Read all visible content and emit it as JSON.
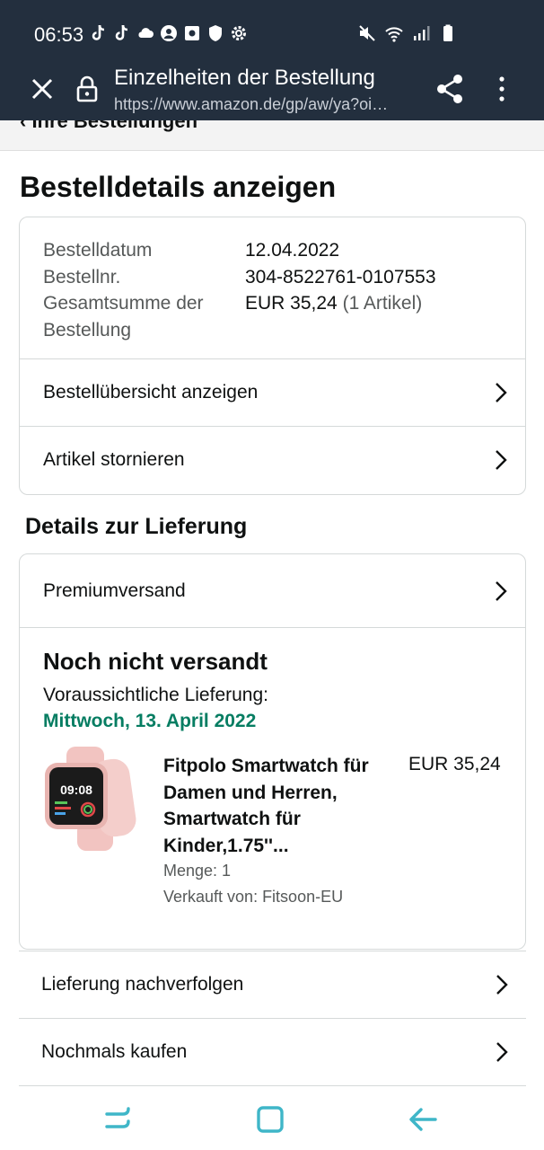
{
  "status_bar": {
    "time": "06:53",
    "left_icons": [
      "tiktok-icon",
      "tiktok-icon",
      "cloud-icon",
      "account-icon",
      "box-icon",
      "shield-icon",
      "settings-icon"
    ],
    "right_icons": [
      "mute-icon",
      "wifi-icon",
      "signal-icon",
      "battery-icon"
    ]
  },
  "browser": {
    "title": "Einzelheiten der Bestellung",
    "url": "https://www.amazon.de/gp/aw/ya?oi…"
  },
  "breadcrumb": "‹ Ihre Bestellungen",
  "page": {
    "title": "Bestelldetails anzeigen"
  },
  "order": {
    "date_label": "Bestelldatum",
    "date_value": "12.04.2022",
    "number_label": "Bestellnr.",
    "number_value": "304-8522761-0107553",
    "total_label_1": "Gesamtsumme der",
    "total_label_2": "Bestellung",
    "total_value": "EUR 35,24",
    "total_items": "(1 Artikel)",
    "summary_link": "Bestellübersicht anzeigen",
    "cancel_link": "Artikel stornieren"
  },
  "delivery": {
    "section_title": "Details zur Lieferung",
    "shipping_method": "Premiumversand",
    "status": "Noch nicht versandt",
    "eta_label": "Voraussichtliche Lieferung:",
    "eta_date": "Mittwoch, 13. April 2022",
    "product": {
      "title": "Fitpolo Smartwatch für Damen und Herren, Smartwatch für Kinder,1.75''...",
      "price": "EUR 35,24",
      "quantity": "Menge: 1",
      "seller": "Verkauft von: Fitsoon-EU",
      "watch_time": "09:08"
    }
  },
  "actions": {
    "track": "Lieferung nachverfolgen",
    "buy_again": "Nochmals kaufen"
  },
  "colors": {
    "header_bg": "#232f3e",
    "delivery_green": "#067d62",
    "watch_pink": "#f4c9c6"
  }
}
